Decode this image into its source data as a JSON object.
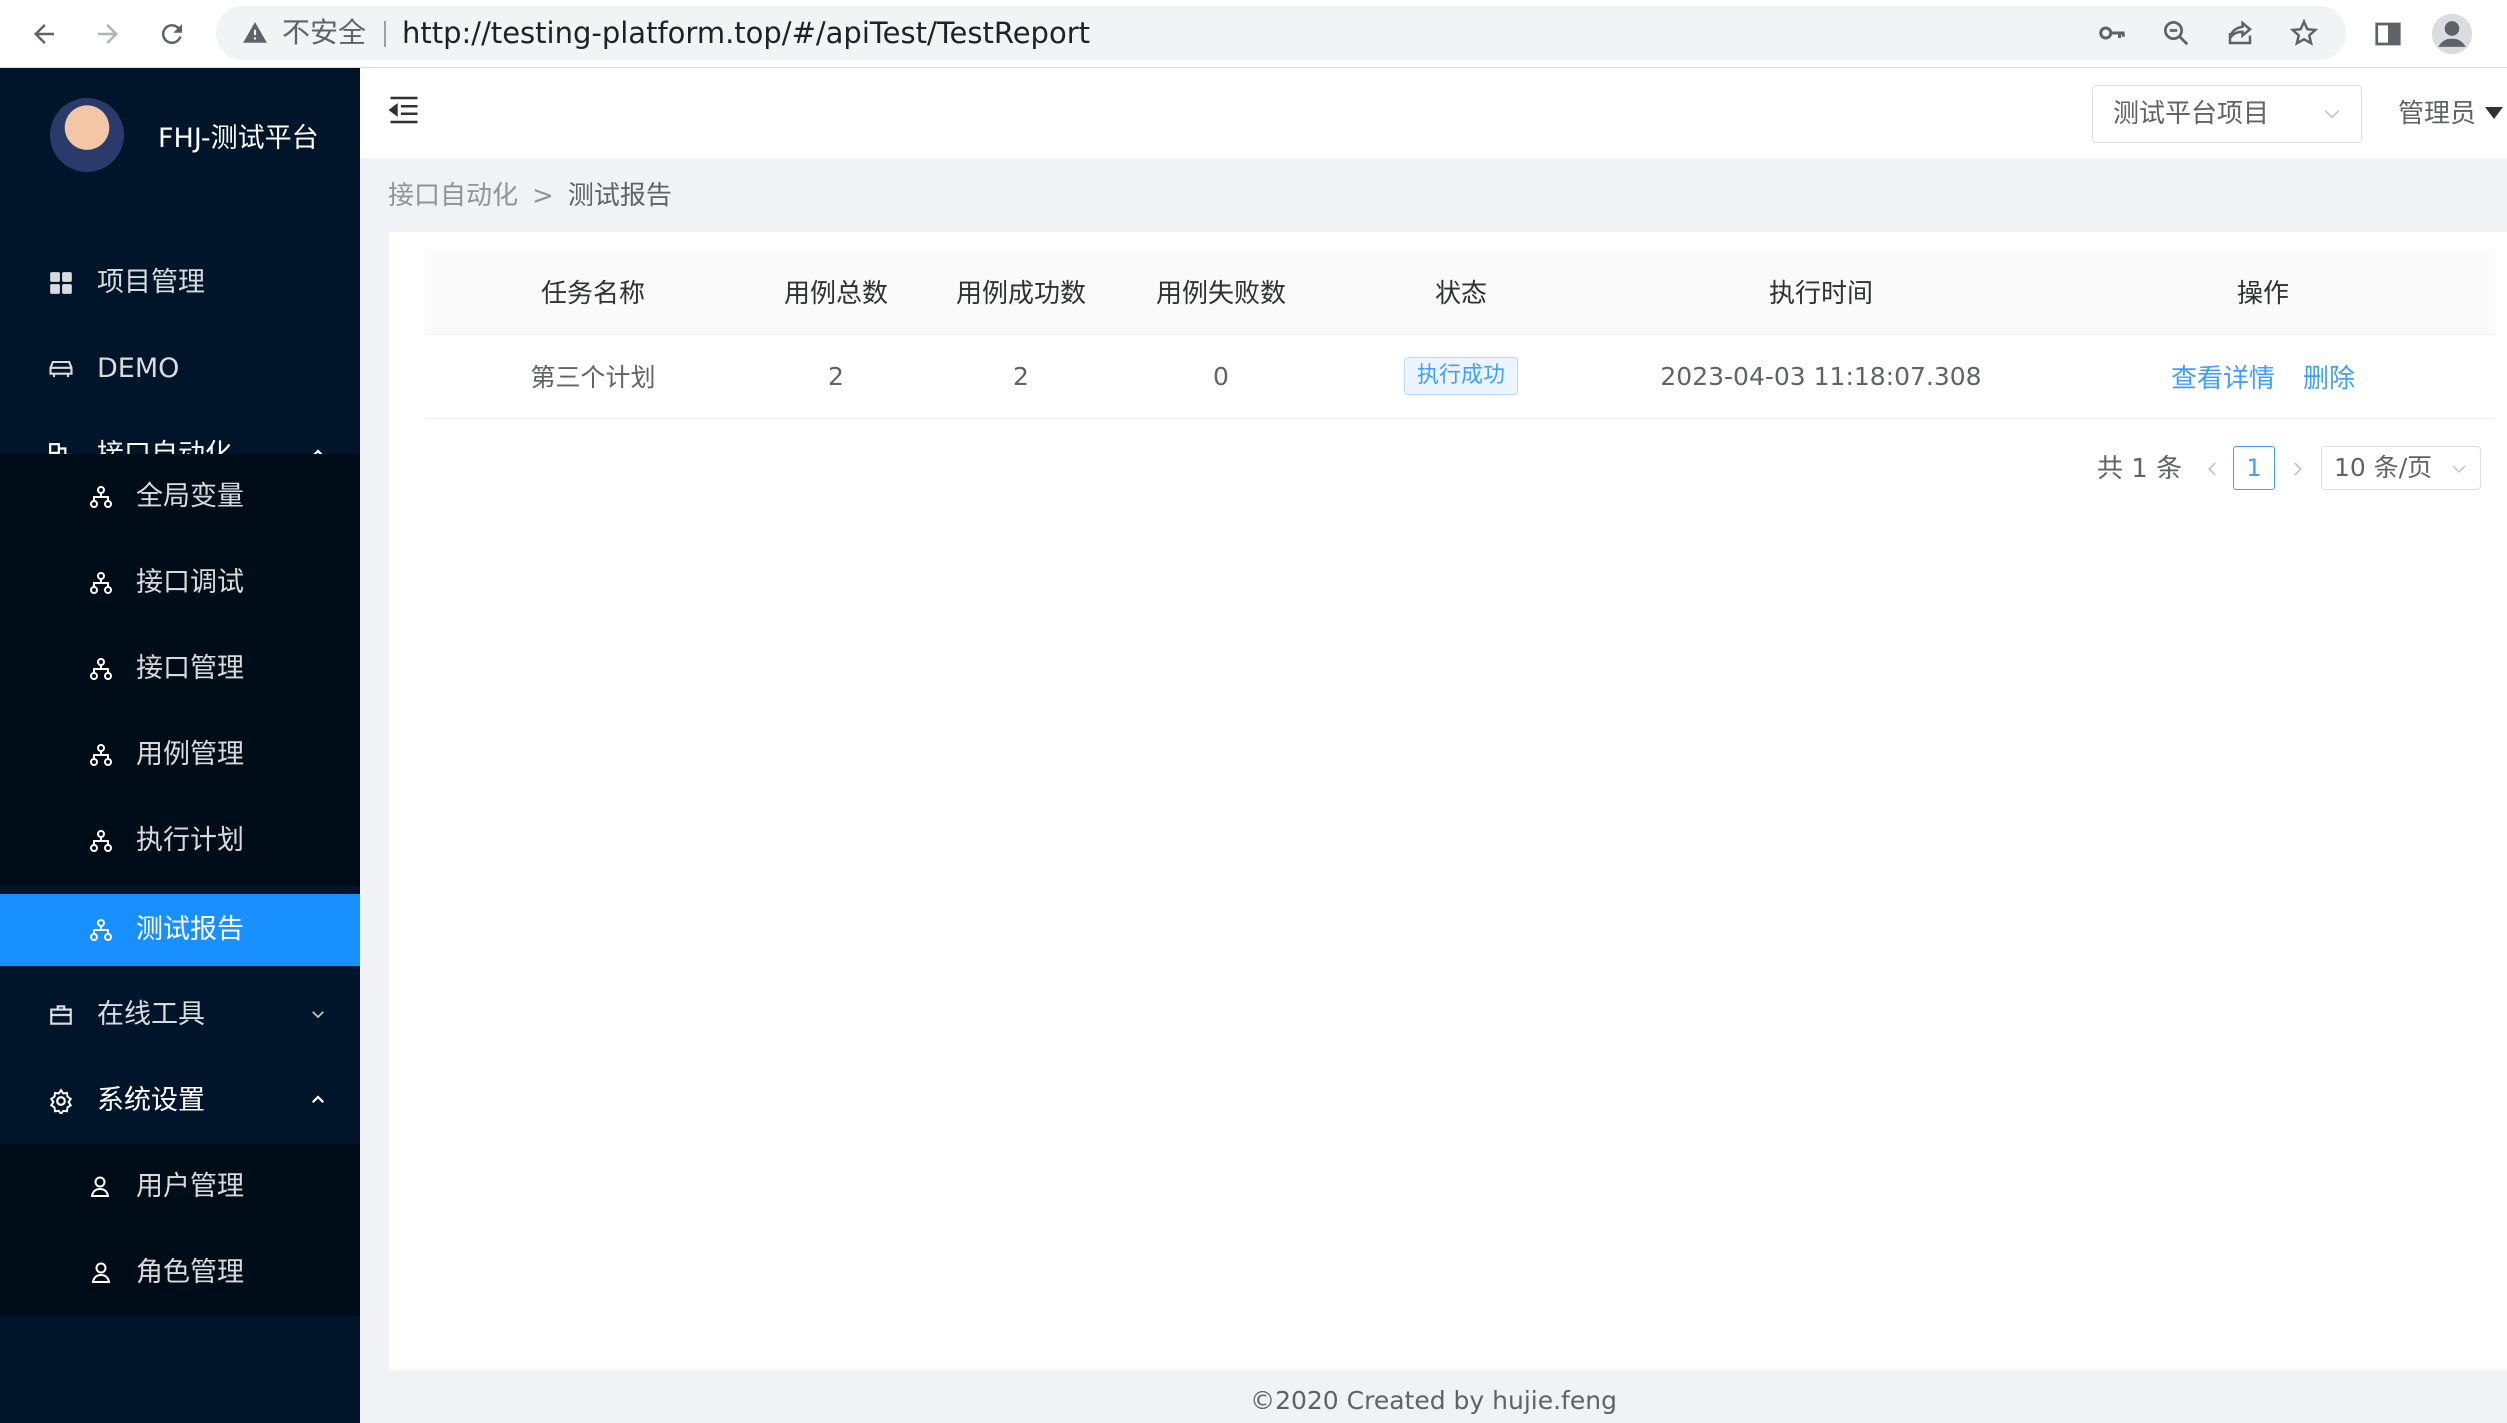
{
  "browser": {
    "security_label": "不安全",
    "url": "http://testing-platform.top/#/apiTest/TestReport",
    "icons": [
      "back-icon",
      "forward-icon",
      "reload-icon",
      "warning-icon",
      "key-icon",
      "zoom-icon",
      "share-icon",
      "star-icon",
      "side-panel-icon",
      "profile-icon"
    ]
  },
  "sidebar": {
    "title": "FHJ-测试平台",
    "items": [
      {
        "label": "项目管理",
        "icon": "grid-icon"
      },
      {
        "label": "DEMO",
        "icon": "car-icon"
      },
      {
        "label": "接口自动化",
        "icon": "api-icon",
        "expanded": true
      },
      {
        "label": "在线工具",
        "icon": "toolbox-icon",
        "expanded": false
      },
      {
        "label": "系统设置",
        "icon": "gear-icon",
        "expanded": true
      }
    ],
    "api_sub": [
      {
        "label": "全局变量"
      },
      {
        "label": "接口调试"
      },
      {
        "label": "接口管理"
      },
      {
        "label": "用例管理"
      },
      {
        "label": "执行计划"
      },
      {
        "label": "测试报告",
        "active": true
      }
    ],
    "settings_sub": [
      {
        "label": "用户管理"
      },
      {
        "label": "角色管理"
      }
    ],
    "accent_color": "#1890ff"
  },
  "header": {
    "project_select": "测试平台项目",
    "user": "管理员"
  },
  "breadcrumb": [
    "接口自动化",
    ">",
    "测试报告"
  ],
  "table": {
    "columns": [
      "任务名称",
      "用例总数",
      "用例成功数",
      "用例失败数",
      "状态",
      "执行时间",
      "操作"
    ],
    "rows": [
      {
        "name": "第三个计划",
        "total": "2",
        "success": "2",
        "fail": "0",
        "status": "执行成功",
        "time": "2023-04-03 11:18:07.308",
        "action_view": "查看详情",
        "action_delete": "删除"
      }
    ]
  },
  "pagination": {
    "total": "共 1 条",
    "current": "1",
    "page_size": "10 条/页"
  },
  "footer": "©2020 Created by hujie.feng"
}
